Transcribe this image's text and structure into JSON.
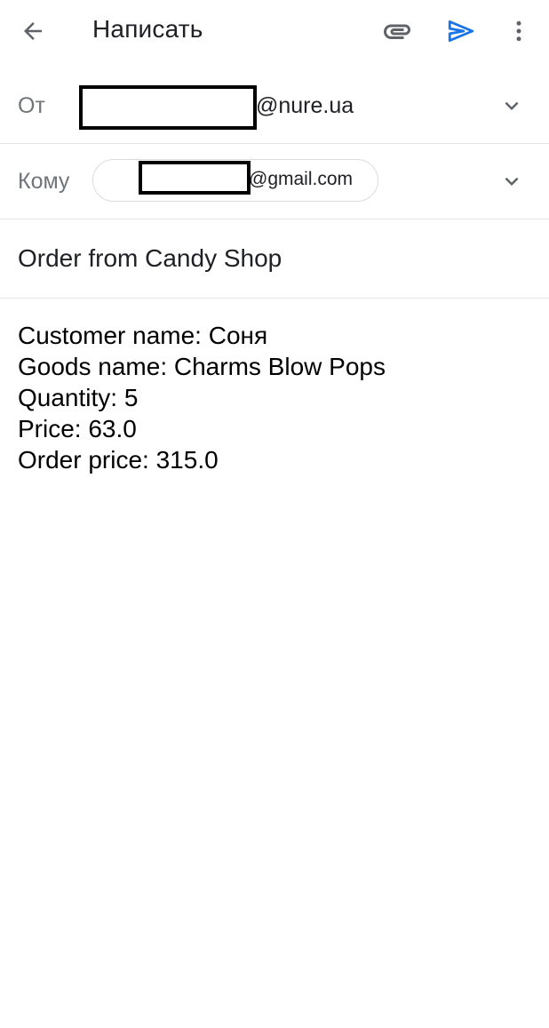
{
  "app_bar": {
    "title": "Написать",
    "back_icon": "arrow-left-icon",
    "attach_icon": "paperclip-icon",
    "send_icon": "send-icon",
    "more_icon": "more-vert-icon",
    "send_color": "#1a73e8"
  },
  "from": {
    "label": "От",
    "address_domain": "@nure.ua",
    "address_redacted": true
  },
  "to": {
    "label": "Кому",
    "recipient_domain": "@gmail.com",
    "recipient_redacted": true
  },
  "subject": "Order from Candy Shop",
  "body": {
    "lines": [
      "Customer name: Соня",
      "Goods name: Charms Blow Pops",
      "Quantity: 5",
      "Price: 63.0",
      "Order price: 315.0"
    ]
  }
}
